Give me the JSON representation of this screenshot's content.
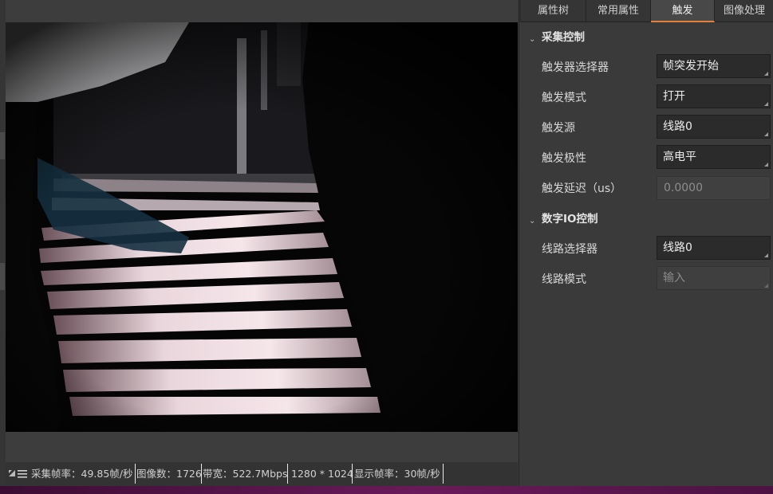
{
  "tabs": [
    {
      "label": "属性树",
      "active": false
    },
    {
      "label": "常用属性",
      "active": false
    },
    {
      "label": "触发",
      "active": true
    },
    {
      "label": "图像处理",
      "active": false
    }
  ],
  "sections": {
    "acquisition": {
      "title": "采集控制",
      "props": [
        {
          "label": "触发器选择器",
          "value": "帧突发开始"
        },
        {
          "label": "触发模式",
          "value": "打开"
        },
        {
          "label": "触发源",
          "value": "线路0"
        },
        {
          "label": "触发极性",
          "value": "高电平"
        },
        {
          "label": "触发延迟（us）",
          "value": "0.0000"
        }
      ]
    },
    "digital_io": {
      "title": "数字IO控制",
      "props": [
        {
          "label": "线路选择器",
          "value": "线路0"
        },
        {
          "label": "线路模式",
          "value": "输入"
        }
      ]
    }
  },
  "status_bar": {
    "frame_rate": "采集帧率：49.85帧/秒",
    "image_count": "图像数：1726",
    "bandwidth": "带宽：522.7Mbps",
    "resolution": "1280 * 1024",
    "display_rate": "显示帧率：30帧/秒"
  },
  "colors": {
    "accent": "#e0803a",
    "panel_bg": "#3a3a3a",
    "field_bg": "#2b2b2b"
  },
  "icons": [
    "chevron-down-icon",
    "resize-icon",
    "menu-icon",
    "dropdown-corner-icon"
  ]
}
